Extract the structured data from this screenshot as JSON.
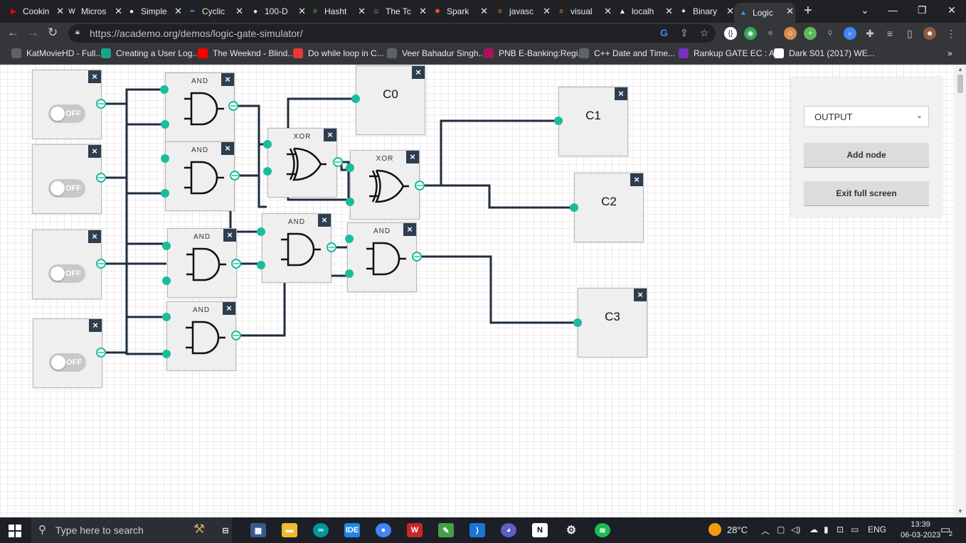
{
  "browser": {
    "tabs": [
      {
        "title": "Cookin",
        "icon": "youtube-icon",
        "color": "#ff0000"
      },
      {
        "title": "Micros",
        "icon": "wordpress-icon",
        "color": "#ffffff"
      },
      {
        "title": "Simple",
        "icon": "github-icon",
        "color": "#ffffff"
      },
      {
        "title": "Cyclic",
        "icon": "pen-icon",
        "color": "#4285f4"
      },
      {
        "title": "100-D",
        "icon": "github-icon",
        "color": "#ffffff"
      },
      {
        "title": "Hasht",
        "icon": "hashtag-icon",
        "color": "#3dae2b"
      },
      {
        "title": "The Tc",
        "icon": "avatar-icon",
        "color": "#d9a27b"
      },
      {
        "title": "Spark",
        "icon": "spark-icon",
        "color": "#e25a1c"
      },
      {
        "title": "javasc",
        "icon": "stackoverflow-icon",
        "color": "#f48024"
      },
      {
        "title": "visual",
        "icon": "stackoverflow-icon",
        "color": "#f48024"
      },
      {
        "title": "localh",
        "icon": "triangle-icon",
        "color": "#ffffff"
      },
      {
        "title": "Binary",
        "icon": "bulb-icon",
        "color": "#ffffff"
      },
      {
        "title": "Logic",
        "icon": "academo-icon",
        "color": "#4a90e2"
      }
    ],
    "url": "https://academo.org/demos/logic-gate-simulator/",
    "bookmarks": [
      {
        "label": "KatMovieHD - Full...",
        "color": "#5f6368"
      },
      {
        "label": "Creating a User Log...",
        "color": "#17a589"
      },
      {
        "label": "The Weeknd - Blind...",
        "color": "#ff0000"
      },
      {
        "label": "Do while loop in C...",
        "color": "#e53935"
      },
      {
        "label": "Veer Bahadur Singh...",
        "color": "#5f6368"
      },
      {
        "label": "PNB E-Banking:Regi...",
        "color": "#a4145c"
      },
      {
        "label": "C++ Date and Time...",
        "color": "#5f6368"
      },
      {
        "label": "Rankup GATE EC : A...",
        "color": "#7b2fbe"
      },
      {
        "label": "Dark S01 (2017) WE...",
        "color": "#ffffff"
      }
    ]
  },
  "simulator": {
    "switches": [
      {
        "state": "OFF"
      },
      {
        "state": "OFF"
      },
      {
        "state": "OFF"
      },
      {
        "state": "OFF"
      }
    ],
    "gates": [
      {
        "type": "AND"
      },
      {
        "type": "AND"
      },
      {
        "type": "XOR"
      },
      {
        "type": "XOR"
      },
      {
        "type": "AND"
      },
      {
        "type": "AND"
      },
      {
        "type": "AND"
      },
      {
        "type": "AND"
      }
    ],
    "outputs": [
      {
        "label": "C0"
      },
      {
        "label": "C1"
      },
      {
        "label": "C2"
      },
      {
        "label": "C3"
      }
    ],
    "wire_color": "#1f2d3d",
    "pin_color": "#1abc9c",
    "close_symbol": "×"
  },
  "panel": {
    "node_type_selected": "OUTPUT",
    "add_node_label": "Add node",
    "exit_fullscreen_label": "Exit full screen"
  },
  "taskbar": {
    "search_placeholder": "Type here to search",
    "temperature": "28°C",
    "language": "ENG",
    "time": "13:39",
    "date": "06-03-2023",
    "notifications": "2"
  }
}
